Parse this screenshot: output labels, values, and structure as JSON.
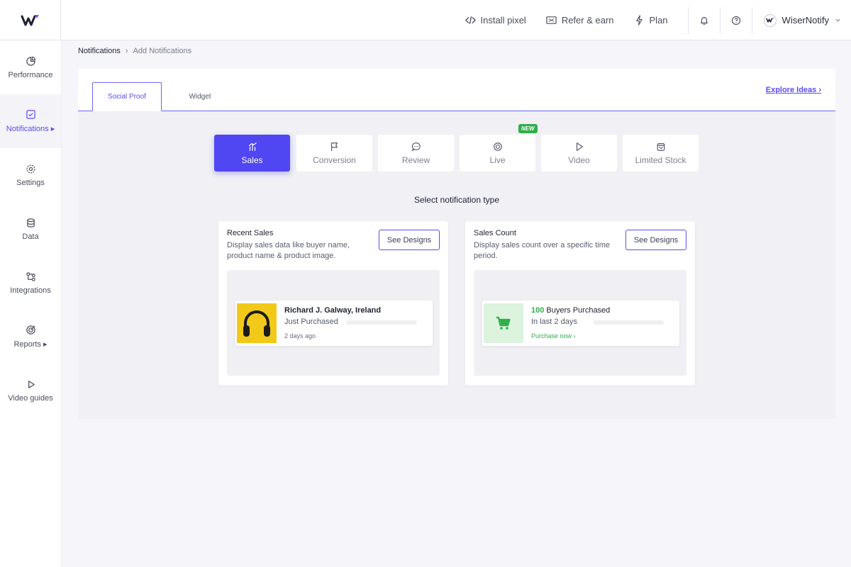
{
  "header": {
    "install_pixel": "Install pixel",
    "refer_earn": "Refer & earn",
    "plan": "Plan",
    "account_name": "WiserNotify"
  },
  "sidebar": {
    "items": [
      {
        "label": "Performance",
        "icon": "pie-chart-icon"
      },
      {
        "label": "Notifications ▸",
        "icon": "notification-check-icon"
      },
      {
        "label": "Settings",
        "icon": "gear-icon"
      },
      {
        "label": "Data",
        "icon": "database-icon"
      },
      {
        "label": "Integrations",
        "icon": "integrations-icon"
      },
      {
        "label": "Reports ▸",
        "icon": "target-icon"
      },
      {
        "label": "Video guides",
        "icon": "play-icon"
      }
    ]
  },
  "breadcrumb": {
    "root": "Notifications",
    "sep": "›",
    "current": "Add Notifications"
  },
  "tabs": {
    "social_proof": "Social Proof",
    "widget": "Widget",
    "explore": "Explore Ideas ›"
  },
  "categories": [
    {
      "label": "Sales",
      "icon": "sales-icon"
    },
    {
      "label": "Conversion",
      "icon": "flag-icon"
    },
    {
      "label": "Review",
      "icon": "chat-icon"
    },
    {
      "label": "Live",
      "icon": "live-icon"
    },
    {
      "label": "Video",
      "icon": "play-icon"
    },
    {
      "label": "Limited Stock",
      "icon": "bag-icon"
    }
  ],
  "new_badge": "NEW",
  "select_title": "Select notification type",
  "cards": {
    "recent": {
      "title": "Recent Sales",
      "desc": "Display sales data like buyer name, product name & product image.",
      "button": "See Designs",
      "notif_name": "Richard J. Galway, Ireland",
      "notif_action": "Just Purchased",
      "notif_time": "2 days ago"
    },
    "count": {
      "title": "Sales Count",
      "desc": "Display sales count over a specific time period.",
      "button": "See Designs",
      "notif_number": "100",
      "notif_text": " Buyers Purchased",
      "notif_sub": "In last 2 days",
      "notif_link": "Purchase now ›"
    }
  },
  "colors": {
    "accent": "#5046f2",
    "green": "#2fae4a"
  }
}
